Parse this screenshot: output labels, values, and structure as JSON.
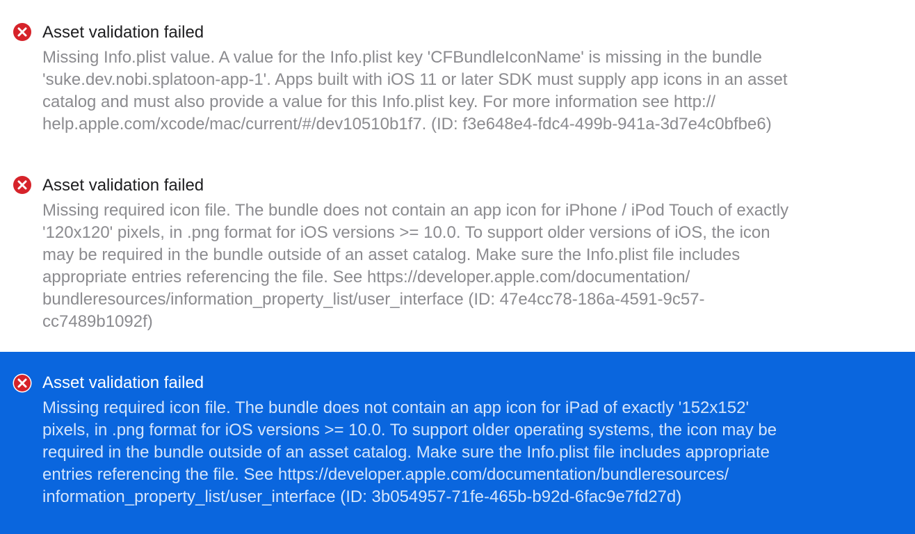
{
  "issues": [
    {
      "title": "Asset validation failed",
      "detail_lines": [
        "Missing Info.plist value. A value for the Info.plist key 'CFBundleIconName' is missing in the bundle",
        "'suke.dev.nobi.splatoon-app-1'. Apps built with iOS 11 or later SDK must supply app icons in an asset",
        "catalog and must also provide a value for this Info.plist key. For more information see http://",
        "help.apple.com/xcode/mac/current/#/dev10510b1f7. (ID: f3e648e4-fdc4-499b-941a-3d7e4c0bfbe6)"
      ],
      "selected": false,
      "icon": "error-x-circle-icon"
    },
    {
      "title": "Asset validation failed",
      "detail_lines": [
        "Missing required icon file. The bundle does not contain an app icon for iPhone / iPod Touch of exactly",
        "'120x120' pixels, in .png format for iOS versions >= 10.0. To support older versions of iOS, the icon",
        "may be required in the bundle outside of an asset catalog. Make sure the Info.plist file includes",
        "appropriate entries referencing the file. See https://developer.apple.com/documentation/",
        "bundleresources/information_property_list/user_interface (ID: 47e4cc78-186a-4591-9c57-",
        "cc7489b1092f)"
      ],
      "selected": false,
      "icon": "error-x-circle-icon"
    },
    {
      "title": "Asset validation failed",
      "detail_lines": [
        "Missing required icon file. The bundle does not contain an app icon for iPad of exactly '152x152'",
        "pixels, in .png format for iOS versions >= 10.0. To support older operating systems, the icon may be",
        "required in the bundle outside of an asset catalog. Make sure the Info.plist file includes appropriate",
        "entries referencing the file. See https://developer.apple.com/documentation/bundleresources/",
        "information_property_list/user_interface (ID: 3b054957-71fe-465b-b92d-6fac9e7fd27d)"
      ],
      "selected": true,
      "icon": "error-x-circle-icon"
    }
  ],
  "colors": {
    "error_red": "#d6232a",
    "selection_blue": "#0a66de",
    "title_text": "#1d1d1f",
    "detail_text": "#8b8b8f"
  }
}
